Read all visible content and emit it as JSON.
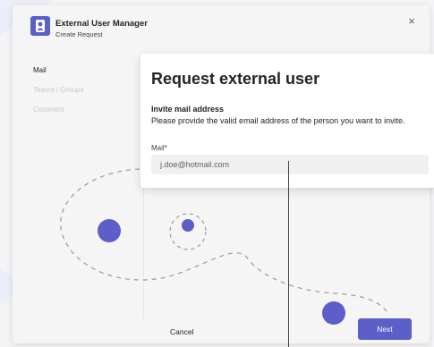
{
  "app": {
    "title": "External User Manager",
    "subtitle": "Create Request",
    "close_symbol": "×"
  },
  "nav": {
    "items": [
      {
        "label": "Mail",
        "active": true
      },
      {
        "label": "Teams / Groups",
        "active": false
      },
      {
        "label": "Comment",
        "active": false
      }
    ]
  },
  "main": {
    "title": "Request external user",
    "section_label": "Invite mail address",
    "section_description": "Please provide the valid email address of the person you want to invite.",
    "mail_field": {
      "label": "Mail*",
      "value": "j.doe@hotmail.com"
    }
  },
  "footer": {
    "cancel_label": "Cancel",
    "next_label": "Next"
  },
  "colors": {
    "accent": "#5b5fc7",
    "background": "#f5f5f5"
  },
  "icons": {
    "app_logo": "app-logo-icon",
    "close": "close-icon"
  }
}
